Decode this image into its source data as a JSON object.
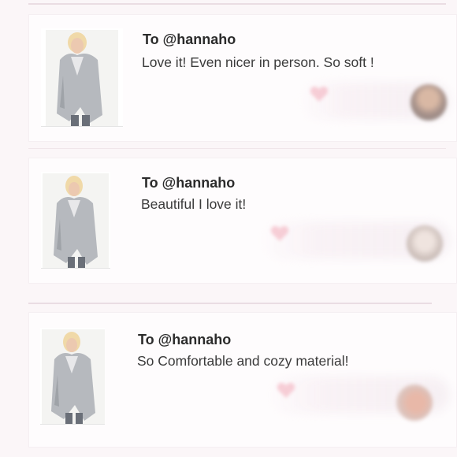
{
  "reviews": [
    {
      "recipient": "To @hannaho",
      "message": "Love it! Even nicer in person. So soft !",
      "product_image": "gray-wrap-cardigan-photo",
      "like_icon": "heart-icon",
      "avatar": "reviewer-avatar"
    },
    {
      "recipient": "To @hannaho",
      "message": "Beautiful I love it!",
      "product_image": "gray-wrap-cardigan-photo",
      "like_icon": "heart-icon",
      "avatar": "reviewer-avatar"
    },
    {
      "recipient": "To @hannaho",
      "message": "So Comfortable and cozy material!",
      "product_image": "gray-wrap-cardigan-photo",
      "like_icon": "heart-icon",
      "avatar": "reviewer-avatar"
    }
  ],
  "colors": {
    "background": "#fbf6f8",
    "card": "#fefcfd",
    "divider": "#eadde3",
    "heart": "#f2aab8",
    "text": "#2b2b2b"
  }
}
